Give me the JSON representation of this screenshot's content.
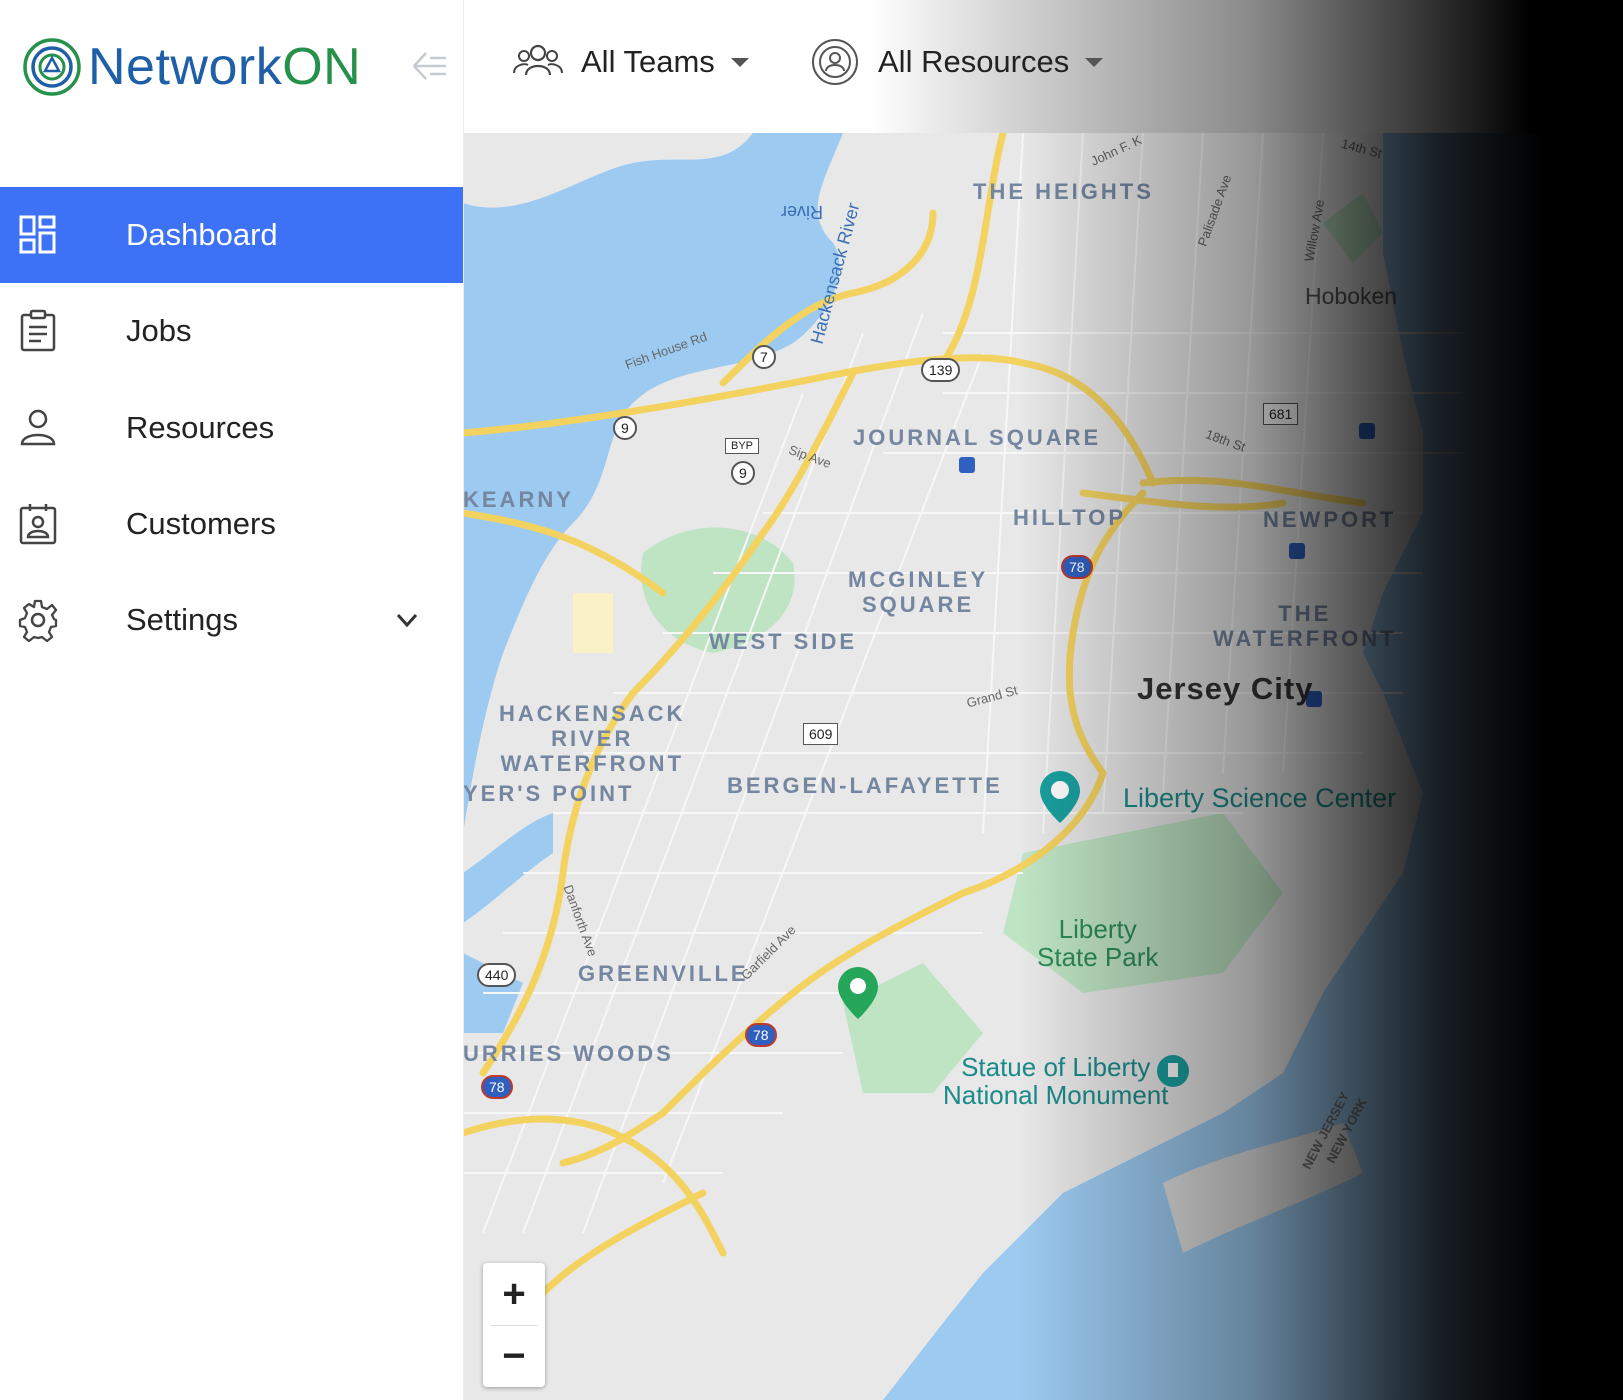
{
  "app": {
    "logo_text_a": "Network",
    "logo_text_b": "ON",
    "colors": {
      "accent": "#3d72f6",
      "logo_blue": "#1f5fa8",
      "logo_green": "#26914a"
    }
  },
  "sidebar": {
    "items": [
      {
        "label": "Dashboard",
        "icon": "dashboard-icon",
        "active": true
      },
      {
        "label": "Jobs",
        "icon": "clipboard-icon"
      },
      {
        "label": "Resources",
        "icon": "person-icon"
      },
      {
        "label": "Customers",
        "icon": "contact-card-icon"
      },
      {
        "label": "Settings",
        "icon": "gear-icon"
      }
    ]
  },
  "topbar": {
    "teams_label": "All Teams",
    "resources_label": "All Resources"
  },
  "map": {
    "neighborhoods": {
      "the_heights": "THE HEIGHTS",
      "journal_square": "JOURNAL SQUARE",
      "kearny": "KEARNY",
      "hilltop": "HILLTOP",
      "newport": "NEWPORT",
      "mcginley_square": "MCGINLEY\nSQUARE",
      "the_waterfront": "THE\nWATERFRONT",
      "west_side": "WEST SIDE",
      "hackensack_river_waterfront": "HACKENSACK\nRIVER\nWATERFRONT",
      "yers_point": "YER'S POINT",
      "bergen_lafayette": "BERGEN-LAFAYETTE",
      "greenville": "GREENVILLE",
      "curries_woods": "URRIES WOODS"
    },
    "places": {
      "hoboken": "Hoboken",
      "jersey_city": "Jersey City",
      "liberty_science_center": "Liberty Science Center",
      "liberty_state_park": "Liberty\nState Park",
      "statue_of_liberty": "Statue of Liberty\nNational Monument",
      "new_jersey": "NEW JERSEY",
      "new_york": "NEW YORK"
    },
    "streets": {
      "hackensack_river": "Hackensack River",
      "river": "River",
      "fish_house_rd": "Fish House Rd",
      "sip_ave": "Sip Ave",
      "grand_st": "Grand St",
      "danforth_ave": "Danforth Ave",
      "garfield_ave": "Garfield Ave",
      "palisade_ave": "Palisade Ave",
      "willow_ave": "Willow Ave",
      "john_f_k": "John F. K",
      "fourteenth_st": "14th St",
      "eighteenth_st": "18th St"
    },
    "route_shields": {
      "r7": "7",
      "r9": "9",
      "r9b": "9",
      "byp": "BYP",
      "r139": "139",
      "r681": "681",
      "r609": "609",
      "r440": "440",
      "i78a": "78",
      "i78b": "78",
      "i78c": "78"
    },
    "zoom_in": "+",
    "zoom_out": "−"
  }
}
